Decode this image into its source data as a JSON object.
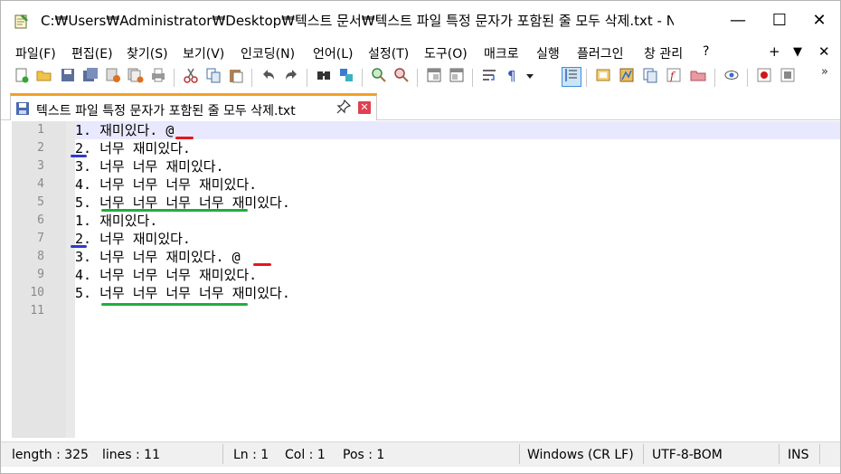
{
  "window": {
    "title": "C:₩Users₩Administrator₩Desktop₩텍스트 문서₩텍스트 파일 특정 문자가 포함된 줄 모두 삭제.txt - No...",
    "minimize": "—",
    "maximize": "☐",
    "close": "✕"
  },
  "menu": {
    "items": [
      "파일(F)",
      "편집(E)",
      "찾기(S)",
      "보기(V)",
      "인코딩(N)",
      "언어(L)",
      "설정(T)",
      "도구(O)",
      "매크로",
      "실행",
      "플러그인",
      "창 관리",
      "?"
    ],
    "right_plus": "+",
    "right_down": "▼",
    "right_close": "✕"
  },
  "toolbar": {
    "more": "»",
    "icons": [
      "new-file-icon",
      "open-file-icon",
      "save-icon",
      "save-all-icon",
      "close-icon",
      "close-all-icon",
      "print-icon",
      "cut-icon",
      "copy-icon",
      "paste-icon",
      "undo-icon",
      "redo-icon",
      "find-icon",
      "replace-icon",
      "zoom-in-icon",
      "zoom-out-icon",
      "sync-vertical-icon",
      "sync-horizontal-icon",
      "word-wrap-icon",
      "show-all-chars-icon",
      "indent-guide-icon",
      "user-lang-icon",
      "doc-map-icon",
      "doc-list-icon",
      "function-list-icon",
      "folder-workspace-icon",
      "monitor-icon",
      "record-macro-icon",
      "stop-record-icon"
    ]
  },
  "tab": {
    "label": "텍스트 파일 특정 문자가 포함된 줄 모두 삭제.txt",
    "pin": "✎",
    "close": "✕"
  },
  "editor": {
    "line_numbers": [
      "1",
      "2",
      "3",
      "4",
      "5",
      "6",
      "7",
      "8",
      "9",
      "10",
      "11"
    ],
    "lines": [
      "1. 재미있다. @",
      "2. 너무 재미있다.",
      "3. 너무 너무 재미있다.",
      "4. 너무 너무 너무 재미있다.",
      "5. 너무 너무 너무 너무 재미있다.",
      "1. 재미있다.",
      "2. 너무 재미있다.",
      "3. 너무 너무 재미있다. @",
      "4. 너무 너무 너무 재미있다.",
      "5. 너무 너무 너무 너무 재미있다.",
      ""
    ],
    "colors": {
      "current_line": "#e8e8ff",
      "red_mark": "#e8161b",
      "blue_mark": "#2b3ad0",
      "green_mark": "#1fae3c"
    }
  },
  "status": {
    "length": "length : 325",
    "lines": "lines : 11",
    "ln": "Ln : 1",
    "col": "Col : 1",
    "pos": "Pos : 1",
    "eol": "Windows (CR LF)",
    "encoding": "UTF-8-BOM",
    "mode": "INS"
  }
}
